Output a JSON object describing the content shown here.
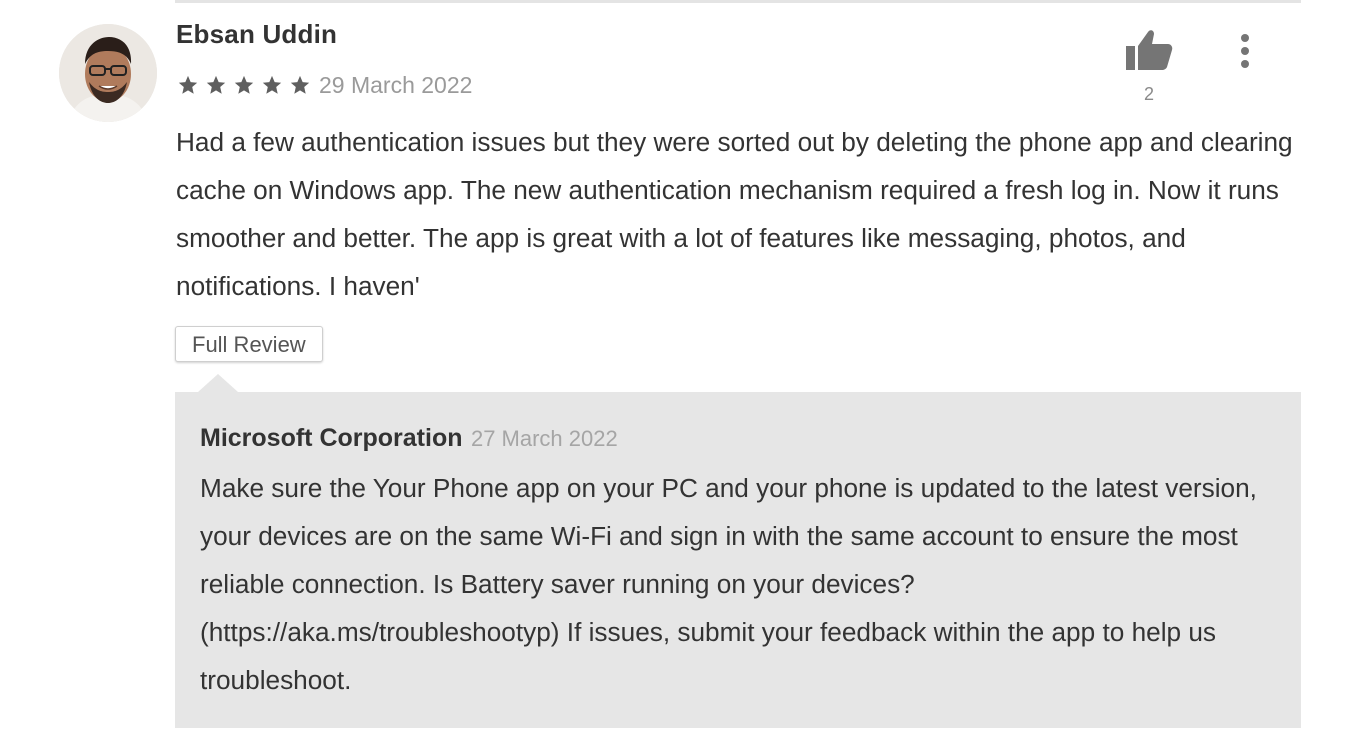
{
  "review": {
    "author": "Ebsan Uddin",
    "rating": 5,
    "date": "29 March 2022",
    "text": "Had a few authentication issues but they were sorted out by deleting the phone app and clearing cache on Windows app. The new authentication mechanism required a fresh log in. Now it runs smoother and better. The app is great with a lot of features like messaging, pho­tos, and notifications. I haven'",
    "helpful_count": "2",
    "full_review_label": "Full Review"
  },
  "reply": {
    "developer": "Microsoft Corporation",
    "date": "27 March 2022",
    "text": "Make sure the Your Phone app on your PC and your phone is updated to the latest version, your devices are on the same Wi-Fi and sign in with the same account to ensure the most reliable connection. Is Battery saver running on your devices? (https://aka.ms/troubleshootyp) If issues, submit your feedback within the app to help us troubleshoot."
  },
  "icons": {
    "thumb": "thumb-up-icon",
    "more": "more-vertical-icon",
    "star": "star-icon"
  },
  "colors": {
    "star": "#5f5f5f",
    "icon": "#757575",
    "reply_background": "#e6e6e6",
    "text": "#333333",
    "muted": "#9a9a9a"
  }
}
